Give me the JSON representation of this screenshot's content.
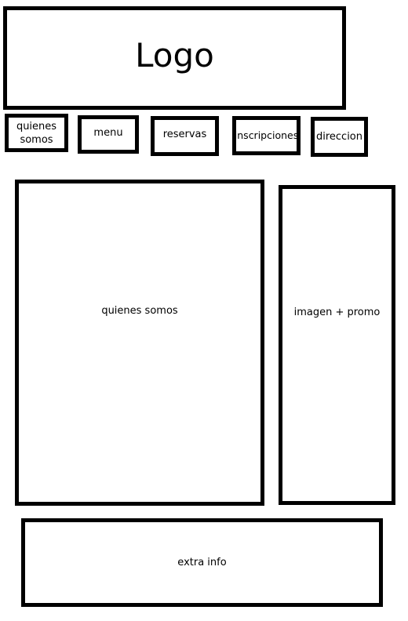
{
  "logo": {
    "label": "Logo"
  },
  "nav": {
    "items": [
      {
        "line1": "quienes",
        "line2": "somos"
      },
      {
        "label": "menu"
      },
      {
        "label": "reservas"
      },
      {
        "label": "inscripciones"
      },
      {
        "label": "direccion"
      }
    ]
  },
  "main": {
    "label": "quienes somos"
  },
  "sidebar": {
    "label": "imagen + promo"
  },
  "footer": {
    "label": "extra info"
  }
}
